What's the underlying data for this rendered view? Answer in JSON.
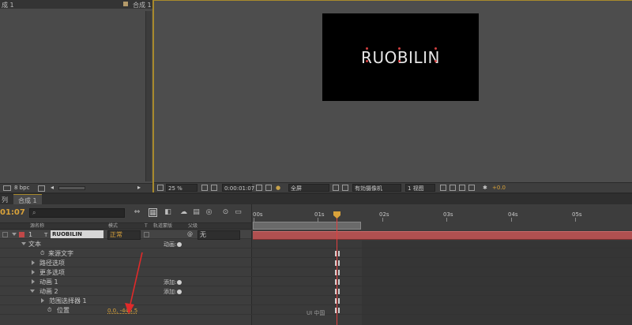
{
  "project": {
    "tab_label": "成 1",
    "tab_right_label": "合成 1",
    "bit_depth": "8 bpc"
  },
  "viewer": {
    "comp_text": "RUOBILIN",
    "zoom": "25 %",
    "timecode": "0:00:01:07",
    "resolution": "全屏",
    "camera": "有効摄像机",
    "views": "1 视图",
    "exposure": "+0.0"
  },
  "timeline": {
    "tab_left": "列",
    "tab_active": "合成 1",
    "timecode": "01:07",
    "columns": {
      "layer_name": "源名称",
      "mode": "模式",
      "t": "T",
      "trkmat": "轨道蒙版",
      "parent": "父级"
    },
    "layers": [
      {
        "index": "1",
        "name": "RUOBILIN",
        "mode": "正常",
        "parent": "无"
      }
    ],
    "properties": {
      "text": "文本",
      "animate": "动画",
      "source_text": "来源文字",
      "path_options": "路径选项",
      "more_options": "更多选项",
      "animator1": "动画 1",
      "animator2": "动画 2",
      "add": "添加",
      "range_selector": "范围选择器 1",
      "position": "位置",
      "position_value": "0.0, -446.5"
    },
    "ruler": [
      "00s",
      "01s",
      "02s",
      "03s",
      "04s",
      "05s"
    ]
  },
  "watermark": "UI 中国",
  "colors": {
    "accent": "#d9a23a",
    "layer_bar": "#b05050",
    "cti": "#e04040",
    "value": "#d9a23a"
  }
}
